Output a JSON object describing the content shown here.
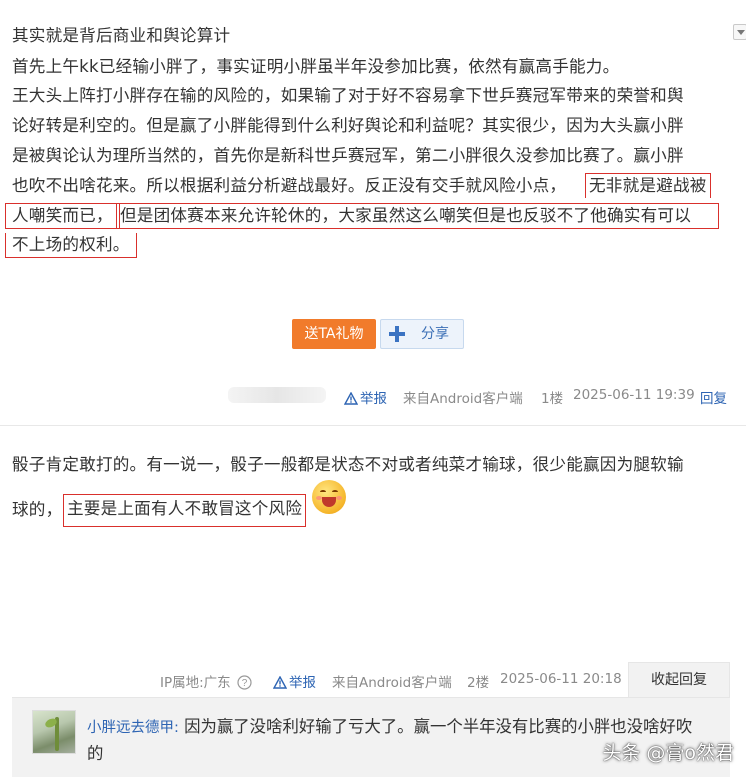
{
  "post1": {
    "lines": [
      "其实就是背后商业和舆论算计",
      "首先上午kk已经输小胖了，事实证明小胖虽半年没参加比赛，依然有赢高手能力。",
      "王大头上阵打小胖存在输的风险的，如果输了对于好不容易拿下世乒赛冠军带来的荣誉和舆",
      "论好转是利空的。但是赢了小胖能得到什么利好舆论和利益呢？其实很少，因为大头赢小胖",
      "是被舆论认为理所当然的，首先你是新科世乒赛冠军，第二小胖很久没参加比赛了。赢小胖",
      "也吹不出啥花来。所以根据利益分析避战最好。反正没有交手就风险小点，",
      "无非就是避战被",
      "人嘲笑而已，",
      "但是团体赛本来允许轮休的，大家虽然这么嘲笑但是也反驳不了他确实有可以",
      "不上场的权利。"
    ],
    "gift_label": "送TA礼物",
    "share_label": "分享",
    "report_label": "举报",
    "source": "来自Android客户端",
    "floor": "1楼",
    "datetime": "2025-06-11 19:39",
    "reply_label": "回复"
  },
  "post2": {
    "line1": "骰子肯定敢打的。有一说一，骰子一般都是状态不对或者纯菜才输球，很少能赢因为腿软输",
    "line2_prefix": "球的，",
    "line2_highlight": "主要是上面有人不敢冒这个风险",
    "ip_label": "IP属地:广东",
    "report_label": "举报",
    "source": "来自Android客户端",
    "floor": "2楼",
    "datetime": "2025-06-11 20:18",
    "collapse_label": "收起回复",
    "reply": {
      "user": "小胖远去德甲:",
      "text": " 因为赢了没啥利好输了亏大了。赢一个半年没有比赛的小胖也没啥好吹的"
    }
  },
  "watermark": "头条 @膏o然君",
  "colors": {
    "highlight_border": "#d9302c",
    "gift_button": "#f17b2b",
    "link_blue": "#2d64b3"
  }
}
